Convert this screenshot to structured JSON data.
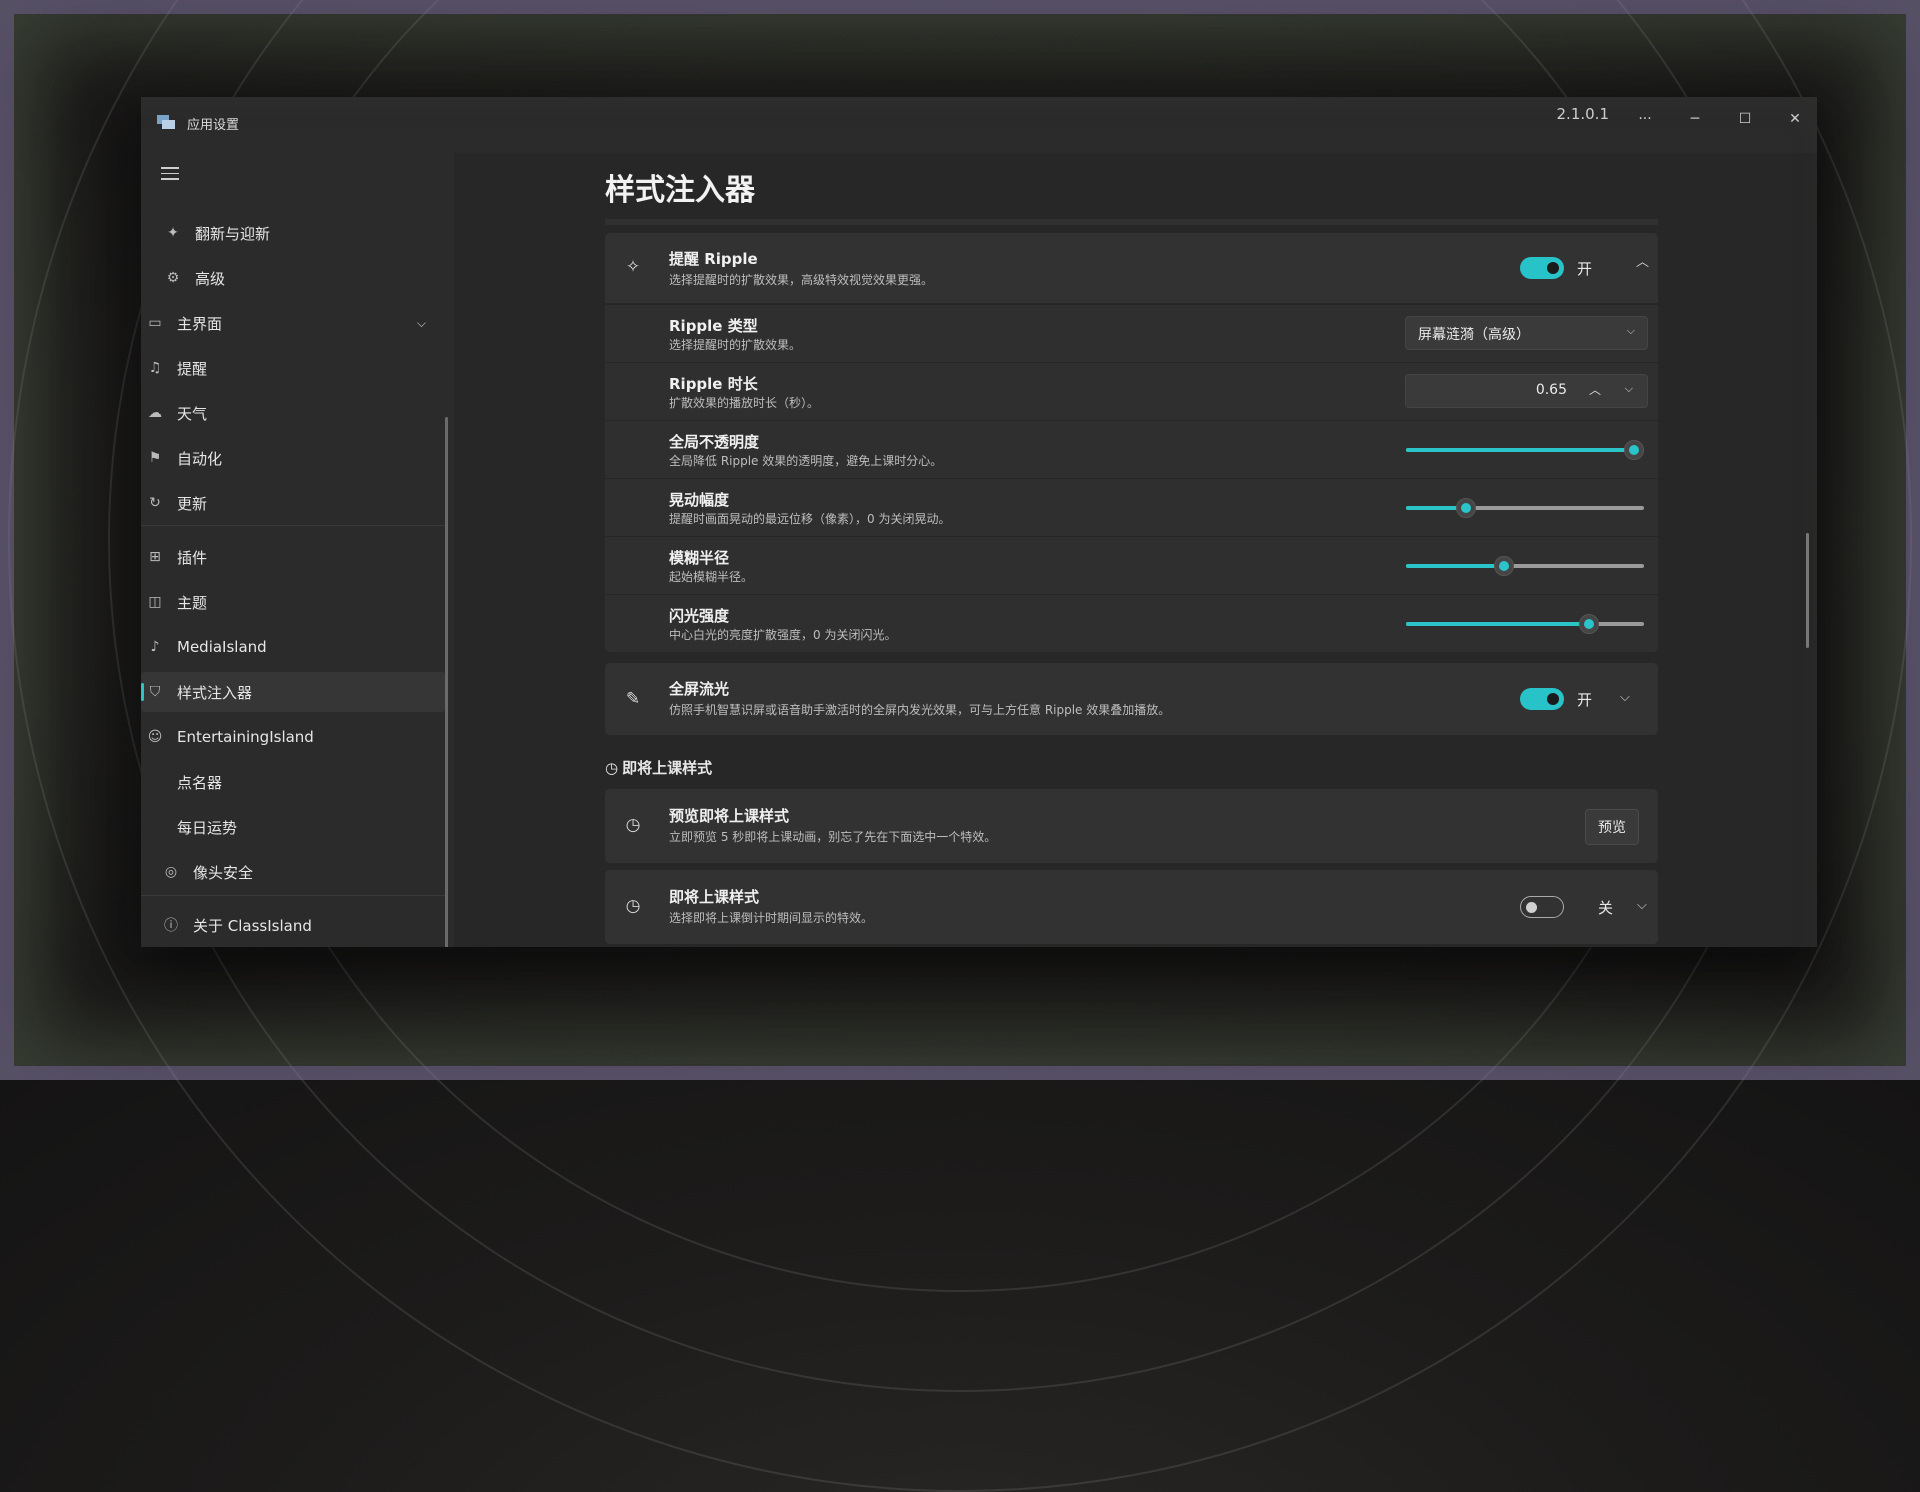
{
  "window": {
    "title": "应用设置",
    "version": "2.1.0.1",
    "more": "···",
    "minimize": "─",
    "maximize": "☐",
    "close": "✕"
  },
  "sidebar": {
    "items": [
      {
        "label": "翻新与迎新",
        "icon": "sparkle-icon"
      },
      {
        "label": "高级",
        "icon": "advanced-icon"
      },
      {
        "label": "主界面",
        "icon": "main-ui-icon"
      },
      {
        "label": "提醒",
        "icon": "bell-icon"
      },
      {
        "label": "天气",
        "icon": "weather-icon"
      },
      {
        "label": "自动化",
        "icon": "automation-icon"
      },
      {
        "label": "更新",
        "icon": "refresh-icon"
      },
      {
        "label": "插件",
        "icon": "plugin-icon"
      },
      {
        "label": "主题",
        "icon": "theme-icon"
      },
      {
        "label": "MediaIsland",
        "icon": "music-icon"
      },
      {
        "label": "样式注入器",
        "icon": "injector-icon"
      },
      {
        "label": "EntertainingIsland",
        "icon": "entertain-icon"
      },
      {
        "label": "点名器",
        "icon": "rollcall-icon"
      },
      {
        "label": "每日运势",
        "icon": "fortune-icon"
      },
      {
        "label": "像头安全",
        "icon": "camera-icon"
      },
      {
        "label": "关于 ClassIsland",
        "icon": "info-icon"
      }
    ]
  },
  "page": {
    "title": "样式注入器",
    "ripple_card": {
      "title": "提醒 Ripple",
      "desc": "选择提醒时的扩散效果，高级特效视觉效果更强。",
      "state": "开"
    },
    "ripple_type": {
      "title": "Ripple 类型",
      "desc": "选择提醒时的扩散效果。",
      "value": "屏幕涟漪（高级）"
    },
    "ripple_duration": {
      "title": "Ripple 时长",
      "desc": "扩散效果的播放时长（秒）。",
      "value": "0.65"
    },
    "opacity": {
      "title": "全局不透明度",
      "desc": "全局降低 Ripple 效果的透明度，避免上课时分心。",
      "level": 0.96
    },
    "shake": {
      "title": "晃动幅度",
      "desc": "提醒时画面晃动的最远位移（像素），0 为关闭晃动。",
      "level": 0.25
    },
    "blur": {
      "title": "模糊半径",
      "desc": "起始模糊半径。",
      "level": 0.41
    },
    "flash": {
      "title": "闪光强度",
      "desc": "中心白光的亮度扩散强度，0 为关闭闪光。",
      "level": 0.77
    },
    "fullscreen_glow": {
      "title": "全屏流光",
      "desc": "仿照手机智慧识屏或语音助手激活时的全屏内发光效果，可与上方任意 Ripple 效果叠加播放。",
      "state": "开"
    },
    "section_upcoming": "即将上课样式",
    "preview_upcoming": {
      "title": "预览即将上课样式",
      "desc": "立即预览 5 秒即将上课动画，别忘了先在下面选中一个特效。",
      "button": "预览"
    },
    "upcoming_style": {
      "title": "即将上课样式",
      "desc": "选择即将上课倒计时期间显示的特效。",
      "state": "关"
    }
  },
  "colors": {
    "accent": "#2bc4c9",
    "background": "#2b2b2b"
  }
}
